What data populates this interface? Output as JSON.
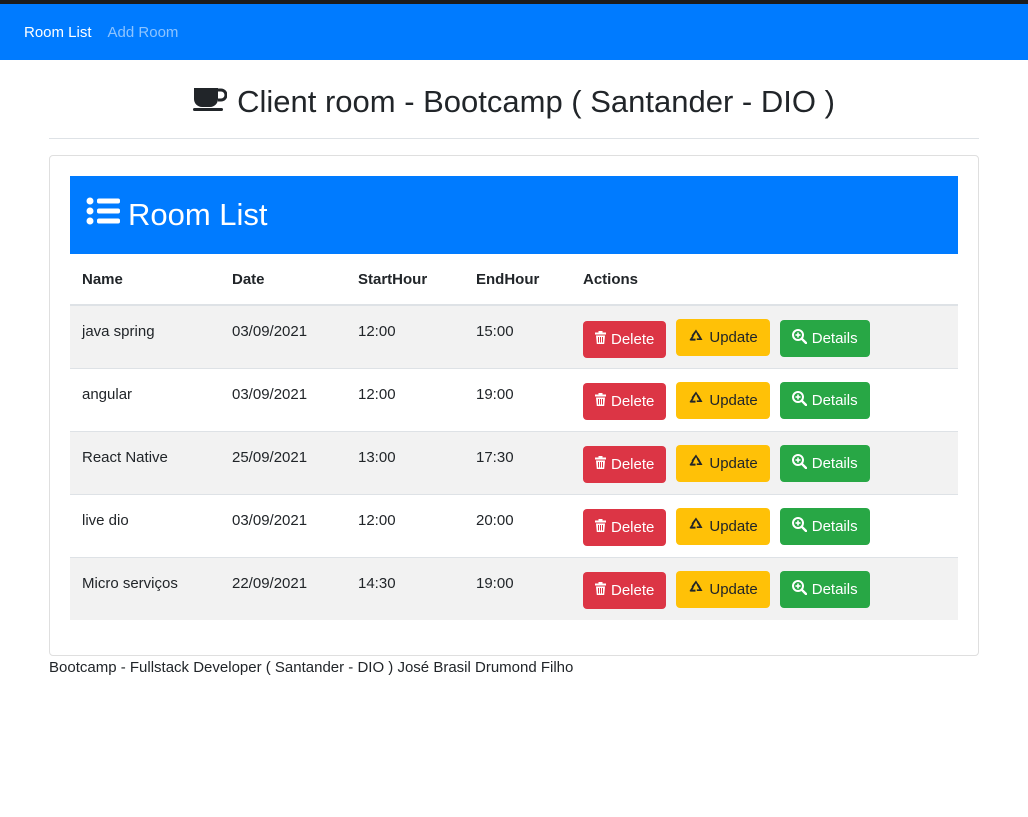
{
  "nav": {
    "items": [
      {
        "label": "Room List"
      },
      {
        "label": "Add Room"
      }
    ]
  },
  "header": {
    "title": "Client room - Bootcamp ( Santander - DIO )",
    "title_icon": "coffee-icon"
  },
  "card": {
    "title": "Room List",
    "title_icon": "list-icon"
  },
  "table": {
    "columns": [
      "Name",
      "Date",
      "StartHour",
      "EndHour",
      "Actions"
    ],
    "rows": [
      {
        "name": "java spring",
        "date": "03/09/2021",
        "start": "12:00",
        "end": "15:00"
      },
      {
        "name": "angular",
        "date": "03/09/2021",
        "start": "12:00",
        "end": "19:00"
      },
      {
        "name": "React Native",
        "date": "25/09/2021",
        "start": "13:00",
        "end": "17:30"
      },
      {
        "name": "live dio",
        "date": "03/09/2021",
        "start": "12:00",
        "end": "20:00"
      },
      {
        "name": "Micro serviços",
        "date": "22/09/2021",
        "start": "14:30",
        "end": "19:00"
      }
    ],
    "actions": {
      "delete": {
        "label": "Delete",
        "icon": "trash-icon"
      },
      "update": {
        "label": "Update",
        "icon": "recycle-icon"
      },
      "details": {
        "label": "Details",
        "icon": "search-plus-icon"
      }
    }
  },
  "footer": {
    "text": "Bootcamp - Fullstack Developer ( Santander - DIO ) José Brasil Drumond Filho"
  },
  "colors": {
    "primary": "#007bff",
    "danger": "#dc3545",
    "warning": "#ffc107",
    "success": "#28a745"
  }
}
